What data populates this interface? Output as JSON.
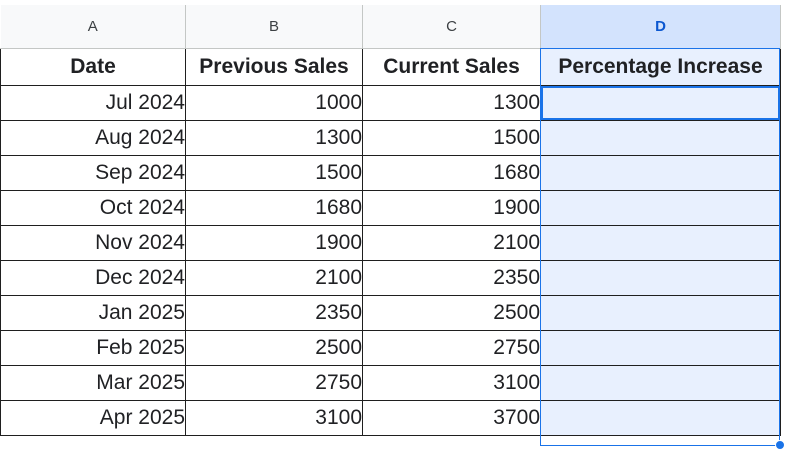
{
  "columns": [
    "A",
    "B",
    "C",
    "D"
  ],
  "headers": [
    "Date",
    "Previous Sales",
    "Current Sales",
    "Percentage Increase"
  ],
  "rows": [
    {
      "date": "Jul 2024",
      "previous": "1000",
      "current": "1300",
      "increase": ""
    },
    {
      "date": "Aug 2024",
      "previous": "1300",
      "current": "1500",
      "increase": ""
    },
    {
      "date": "Sep 2024",
      "previous": "1500",
      "current": "1680",
      "increase": ""
    },
    {
      "date": "Oct 2024",
      "previous": "1680",
      "current": "1900",
      "increase": ""
    },
    {
      "date": "Nov 2024",
      "previous": "1900",
      "current": "2100",
      "increase": ""
    },
    {
      "date": "Dec 2024",
      "previous": "2100",
      "current": "2350",
      "increase": ""
    },
    {
      "date": "Jan 2025",
      "previous": "2350",
      "current": "2500",
      "increase": ""
    },
    {
      "date": "Feb 2025",
      "previous": "2500",
      "current": "2750",
      "increase": ""
    },
    {
      "date": "Mar 2025",
      "previous": "2750",
      "current": "3100",
      "increase": ""
    },
    {
      "date": "Apr 2025",
      "previous": "3100",
      "current": "3700",
      "increase": ""
    }
  ],
  "selected_column": "D",
  "colors": {
    "selection": "#1a73e8",
    "selection_fill": "#e8f0fe",
    "header_selected": "#d3e3fd"
  }
}
